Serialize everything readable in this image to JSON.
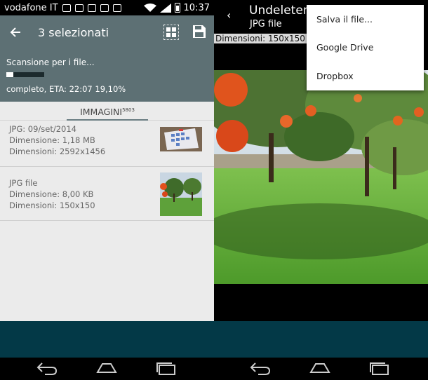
{
  "status_bar": {
    "carrier": "vodafone IT",
    "time": "10:37"
  },
  "left": {
    "app_bar": {
      "title": "3 selezionati",
      "icons": [
        "back-arrow-icon",
        "grid-view-icon",
        "save-icon"
      ]
    },
    "scan": {
      "title": "Scansione per i file...",
      "progress_percent": 19.1,
      "status": "completo, ETA: 22:07 19,10%"
    },
    "tab": {
      "label": "IMMAGINI",
      "count": "5803"
    },
    "files": [
      {
        "line1": "JPG: 09/set/2014",
        "line2": "Dimensione: 1,18 MB",
        "line3": "Dimensioni: 2592x1456"
      },
      {
        "line1": "JPG file",
        "line2": "Dimensione: 8,00 KB",
        "line3": "Dimensioni: 150x150"
      }
    ]
  },
  "right": {
    "title": "Undeleter",
    "subtitle": "JPG file",
    "dimensions": "Dimensioni: 150x150",
    "menu": [
      "Salva il file...",
      "Google Drive",
      "Dropbox"
    ]
  },
  "colors": {
    "app_bar": "#5d7074",
    "bottom_bar": "#033947",
    "list_bg": "#ebebeb"
  }
}
